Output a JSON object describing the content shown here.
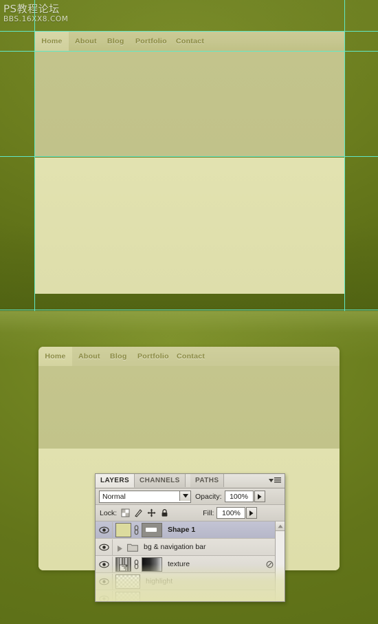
{
  "watermark": {
    "line1": "PS教程论坛",
    "line2": "BBS.16XX8.COM"
  },
  "colors": {
    "background_green": "#67781c",
    "guide_cyan": "#61e8c6",
    "nav_bar": "#c6c68f",
    "panel_upper": "#c2c389",
    "panel_lower": "#e0e0ae",
    "nav_text": "#8a8a43",
    "ps_chrome": "#d4d0c8",
    "ps_selected_row": "#bcbdcd"
  },
  "top_mockup": {
    "nav": {
      "items": [
        {
          "label": "Home",
          "active": true
        },
        {
          "label": "About",
          "active": false
        },
        {
          "label": "Blog",
          "active": false
        },
        {
          "label": "Portfolio",
          "active": false
        },
        {
          "label": "Contact",
          "active": false
        }
      ]
    }
  },
  "bottom_mockup": {
    "nav": {
      "items": [
        {
          "label": "Home",
          "active": true
        },
        {
          "label": "About",
          "active": false
        },
        {
          "label": "Blog",
          "active": false
        },
        {
          "label": "Portfolio",
          "active": false
        },
        {
          "label": "Contact",
          "active": false
        }
      ]
    }
  },
  "layers_panel": {
    "tabs": [
      {
        "label": "LAYERS",
        "active": true
      },
      {
        "label": "CHANNELS",
        "active": false
      },
      {
        "label": "PATHS",
        "active": false
      }
    ],
    "menu_icon": "panel-menu-icon",
    "blend_mode": {
      "value": "Normal",
      "arrow_icon": "chevron-down-icon"
    },
    "opacity": {
      "label": "Opacity:",
      "value": "100%",
      "spinner_icon": "triangle-right-icon"
    },
    "lock": {
      "label": "Lock:",
      "icons": [
        "lock-transparent-pixels-icon",
        "lock-image-pixels-icon",
        "lock-position-icon",
        "lock-all-icon"
      ]
    },
    "fill": {
      "label": "Fill:",
      "value": "100%",
      "spinner_icon": "triangle-right-icon"
    },
    "layers": [
      {
        "name": "Shape 1",
        "visible": true,
        "selected": true,
        "bold": true,
        "type": "shape",
        "thumb": "solid-color-swatch",
        "link_icon": "link-icon",
        "mask_thumb": "vector-mask"
      },
      {
        "name": "bg & navigation bar",
        "visible": true,
        "selected": false,
        "bold": false,
        "type": "group",
        "expand_icon": "triangle-right-icon",
        "folder_icon": "folder-icon"
      },
      {
        "name": "texture",
        "visible": true,
        "selected": false,
        "bold": false,
        "type": "raster",
        "thumb": "texture-thumbnail",
        "clipping_icon": "clipping-mask-icon",
        "link_icon": "link-icon",
        "mask_thumb": "gradient-layer-mask",
        "fx_icon": "layer-style-icon",
        "collapse_icon": "triangle-down-icon"
      },
      {
        "name": "highlight",
        "visible": true,
        "selected": false,
        "bold": false,
        "type": "raster",
        "thumb": "transparent-checkerboard",
        "dimmed": true
      }
    ],
    "scrollbar": {
      "up_arrow_icon": "scroll-up-arrow-icon"
    }
  }
}
